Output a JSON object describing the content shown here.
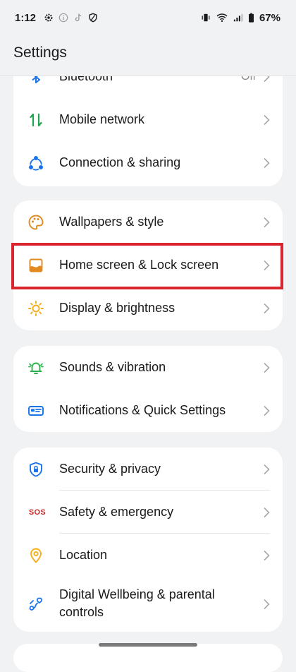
{
  "status_bar": {
    "time": "1:12",
    "battery": "67%"
  },
  "title": "Settings",
  "cards": [
    {
      "items": [
        {
          "label": "Bluetooth",
          "value": "Off",
          "icon": "bluetooth-icon"
        },
        {
          "label": "Mobile network",
          "icon": "mobile-network-icon"
        },
        {
          "label": "Connection & sharing",
          "icon": "connection-sharing-icon"
        }
      ]
    },
    {
      "items": [
        {
          "label": "Wallpapers & style",
          "icon": "palette-icon"
        },
        {
          "label": "Home screen & Lock screen",
          "icon": "home-screen-icon"
        },
        {
          "label": "Display & brightness",
          "icon": "sun-icon"
        }
      ]
    },
    {
      "items": [
        {
          "label": "Sounds & vibration",
          "icon": "bell-icon"
        },
        {
          "label": "Notifications & Quick Settings",
          "icon": "notifications-icon"
        }
      ]
    },
    {
      "items": [
        {
          "label": "Security & privacy",
          "icon": "shield-icon"
        },
        {
          "label": "Safety & emergency",
          "icon": "sos-icon"
        },
        {
          "label": "Location",
          "icon": "location-pin-icon"
        },
        {
          "label": "Digital Wellbeing & parental",
          "label2": "controls",
          "icon": "wellbeing-icon"
        }
      ]
    }
  ],
  "sos_text": "SOS",
  "colors": {
    "bluetooth": "#1a73e8",
    "mobile_network": "#1fa54b",
    "connection": "#1a73e8",
    "wallpapers": "#e08a1f",
    "home_screen": "#e08a1f",
    "display": "#f2b01e",
    "sounds": "#2bb24c",
    "notifications": "#1a73e8",
    "security": "#1a73e8",
    "sos": "#c62828",
    "location": "#f2b01e",
    "wellbeing": "#1a73e8",
    "highlight": "#d9262e"
  }
}
